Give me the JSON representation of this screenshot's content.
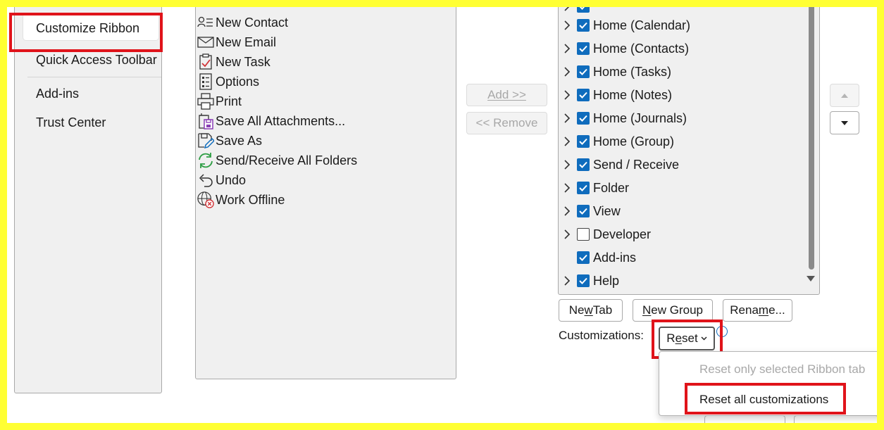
{
  "nav": {
    "items": [
      {
        "label": "Customize Ribbon",
        "selected": true
      },
      {
        "label": "Quick Access Toolbar"
      },
      {
        "label": "Add-ins"
      },
      {
        "label": "Trust Center"
      }
    ]
  },
  "commands": {
    "items": [
      {
        "label": "New Contact",
        "icon": "contact-card-icon"
      },
      {
        "label": "New Email",
        "icon": "envelope-icon"
      },
      {
        "label": "New Task",
        "icon": "task-clipboard-icon"
      },
      {
        "label": "Options",
        "icon": "options-list-icon"
      },
      {
        "label": "Print",
        "icon": "printer-icon"
      },
      {
        "label": "Save All Attachments...",
        "icon": "save-attachments-icon"
      },
      {
        "label": "Save As",
        "icon": "save-as-icon"
      },
      {
        "label": "Send/Receive All Folders",
        "icon": "sync-arrows-icon"
      },
      {
        "label": "Undo",
        "icon": "undo-icon"
      },
      {
        "label": "Work Offline",
        "icon": "globe-offline-icon"
      }
    ]
  },
  "transfer": {
    "add_label": "Add >>",
    "remove_label": "<< Remove"
  },
  "ribbon_tabs": {
    "items": [
      {
        "label": "Home (Calendar)",
        "checked": true,
        "expandable": true
      },
      {
        "label": "Home (Contacts)",
        "checked": true,
        "expandable": true
      },
      {
        "label": "Home (Tasks)",
        "checked": true,
        "expandable": true
      },
      {
        "label": "Home (Notes)",
        "checked": true,
        "expandable": true
      },
      {
        "label": "Home (Journals)",
        "checked": true,
        "expandable": true
      },
      {
        "label": "Home (Group)",
        "checked": true,
        "expandable": true
      },
      {
        "label": "Send / Receive",
        "checked": true,
        "expandable": true
      },
      {
        "label": "Folder",
        "checked": true,
        "expandable": true
      },
      {
        "label": "View",
        "checked": true,
        "expandable": true
      },
      {
        "label": "Developer",
        "checked": false,
        "expandable": true
      },
      {
        "label": "Add-ins",
        "checked": true,
        "expandable": false
      },
      {
        "label": "Help",
        "checked": true,
        "expandable": true
      }
    ]
  },
  "tab_buttons": {
    "new_tab": {
      "pre": "Ne",
      "accel": "w",
      "post": " Tab"
    },
    "new_group": {
      "pre": "",
      "accel": "N",
      "post": "ew Group"
    },
    "rename": {
      "pre": "Rena",
      "accel": "m",
      "post": "e..."
    }
  },
  "customizations": {
    "label": "Customizations:",
    "reset": {
      "pre": "R",
      "accel": "e",
      "post": "set"
    },
    "menu": [
      {
        "label": "Reset only selected Ribbon tab",
        "disabled": true
      },
      {
        "label": "Reset all customizations",
        "disabled": false
      }
    ]
  },
  "colors": {
    "highlight": "#e0131a",
    "accent": "#0f6cbd",
    "frame": "#ffff33"
  }
}
